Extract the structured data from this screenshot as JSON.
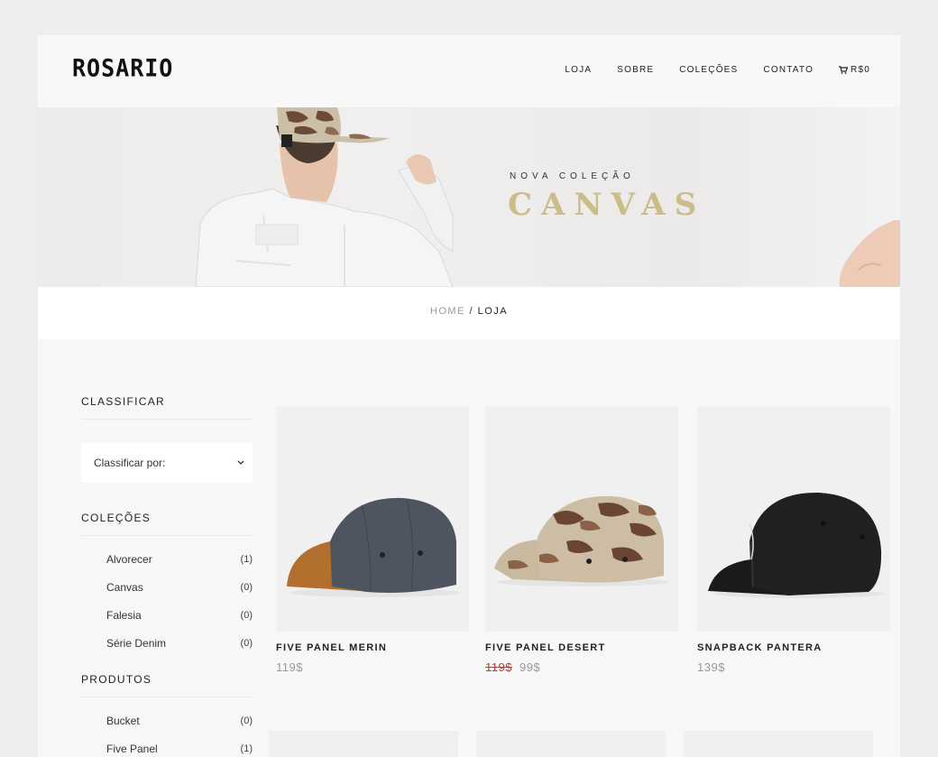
{
  "header": {
    "logo": "ROSARIO",
    "nav": [
      "LOJA",
      "SOBRE",
      "COLEÇÕES",
      "CONTATO"
    ],
    "cart": "R$0"
  },
  "hero": {
    "subtitle": "NOVA COLEÇÃO",
    "title": "CANVAS"
  },
  "breadcrumb": {
    "home": "HOME",
    "separator": "/",
    "current": "LOJA"
  },
  "sidebar": {
    "sort_heading": "CLASSIFICAR",
    "sort_select": "Classificar por:",
    "collections_heading": "COLEÇÕES",
    "collections": [
      {
        "label": "Alvorecer",
        "count": "(1)"
      },
      {
        "label": "Canvas",
        "count": "(0)"
      },
      {
        "label": "Falesia",
        "count": "(0)"
      },
      {
        "label": "Série Denim",
        "count": "(0)"
      }
    ],
    "products_heading": "PRODUTOS",
    "products": [
      {
        "label": "Bucket",
        "count": "(0)"
      },
      {
        "label": "Five Panel",
        "count": "(1)"
      }
    ]
  },
  "products": [
    {
      "name": "FIVE PANEL MERIN",
      "price": "119$",
      "old_price": ""
    },
    {
      "name": "FIVE PANEL DESERT",
      "price": "99$",
      "old_price": "119$"
    },
    {
      "name": "SNAPBACK PANTERA",
      "price": "139$",
      "old_price": ""
    }
  ],
  "colors": {
    "accent_gold": "#cbbd8a",
    "sale_red": "#c0392b",
    "background": "#edeef0"
  }
}
